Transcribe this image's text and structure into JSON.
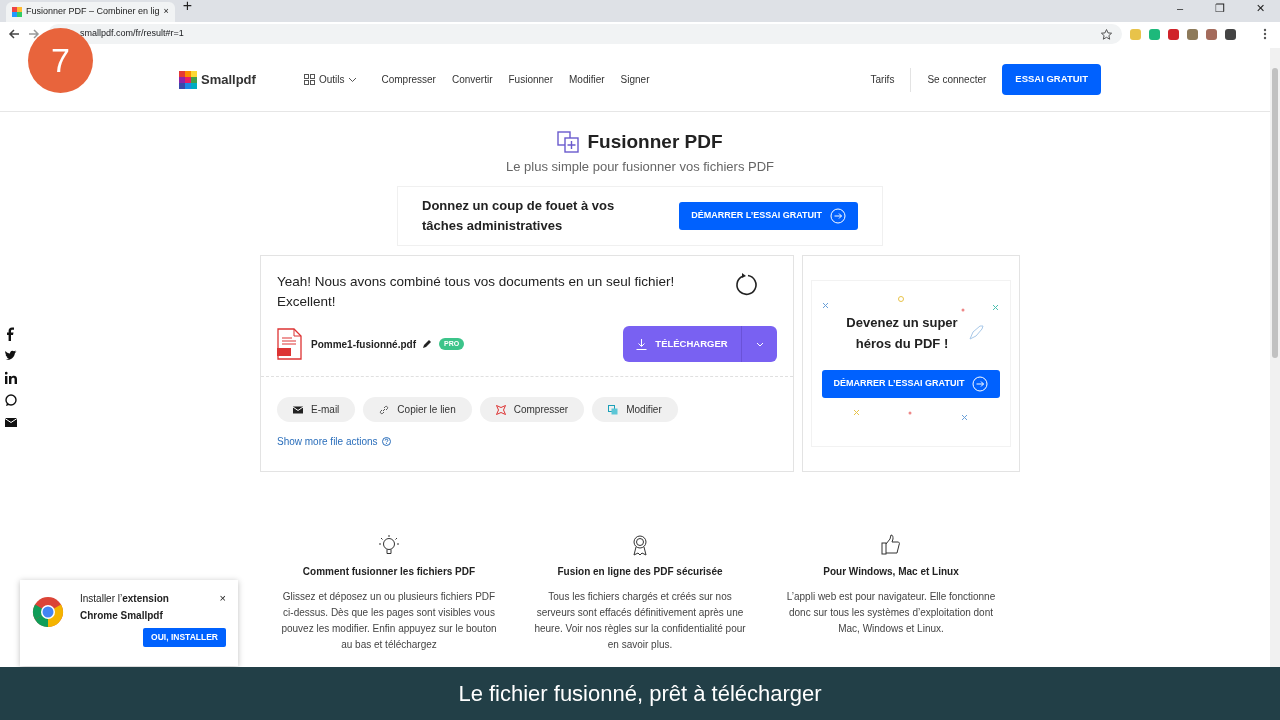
{
  "browser": {
    "tab_title": "Fusionner PDF – Combiner en lig",
    "tab_close": "×",
    "new_tab": "+",
    "url": "smallpdf.com/fr/result#r=1",
    "window_buttons": [
      "–",
      "❐",
      "✕"
    ]
  },
  "step_badge": "7",
  "nav": {
    "logo": "Smallpdf",
    "tools": "Outils",
    "links": [
      "Compresser",
      "Convertir",
      "Fusionner",
      "Modifier",
      "Signer"
    ],
    "pricing": "Tarifs",
    "login": "Se connecter",
    "cta": "ESSAI GRATUIT"
  },
  "hero": {
    "title": "Fusionner PDF",
    "subtitle": "Le plus simple pour fusionner vos fichiers PDF"
  },
  "promo": {
    "text": "Donnez un coup de fouet à vos tâches administratives",
    "button": "DÉMARRER L’ESSAI GRATUIT"
  },
  "result": {
    "message_lines": [
      "Yeah! Nous avons combiné tous vos documents en un seul fichier!",
      "Excellent!"
    ],
    "file_name": "Pomme1-fusionné.pdf",
    "badge": "PRO",
    "download": "TÉLÉCHARGER",
    "actions": [
      {
        "kind": "email",
        "label": "E-mail"
      },
      {
        "kind": "link",
        "label": "Copier le lien"
      },
      {
        "kind": "compress",
        "label": "Compresser"
      },
      {
        "kind": "edit",
        "label": "Modifier"
      }
    ],
    "more": "Show more file actions"
  },
  "side_promo": {
    "title": "Devenez un super héros du PDF !",
    "button": "DÉMARRER L’ESSAI GRATUIT"
  },
  "features": [
    {
      "kind": "bulb",
      "title": "Comment fusionner les fichiers PDF",
      "text": "Glissez et déposez un ou plusieurs fichiers PDF ci-dessus. Dès que les pages sont visibles vous pouvez les modifier. Enfin appuyez sur le bouton au bas et téléchargez"
    },
    {
      "kind": "award",
      "title": "Fusion en ligne des PDF sécurisée",
      "text": "Tous les fichiers chargés et créés sur nos serveurs sont effacés définitivement après une heure. Voir nos règles sur la confidentialité pour en savoir plus."
    },
    {
      "kind": "thumb",
      "title": "Pour Windows, Mac et Linux",
      "text": "L’appli web est pour navigateur. Elle fonctionne donc sur tous les systèmes d’exploitation dont Mac, Windows et Linux."
    }
  ],
  "chrome_popup": {
    "text": "Installer l’**extension Chrome Smallpdf**",
    "close": "×",
    "button": "OUI, INSTALLER"
  },
  "caption": "Le fichier fusionné, prêt à télécharger"
}
